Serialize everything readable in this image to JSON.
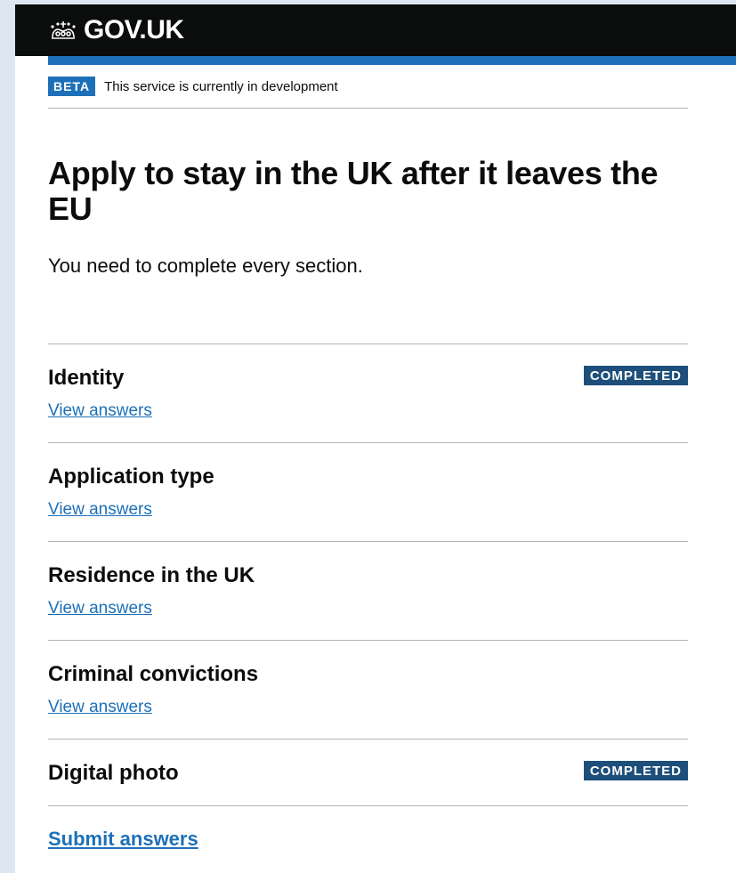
{
  "header": {
    "logo_text": "GOV.UK"
  },
  "phase_banner": {
    "tag": "BETA",
    "text": "This service is currently in development"
  },
  "main": {
    "title": "Apply to stay in the UK after it leaves the EU",
    "lead": "You need to complete every section.",
    "tasks": [
      {
        "name": "Identity",
        "link": "View answers",
        "status": "COMPLETED"
      },
      {
        "name": "Application type",
        "link": "View answers"
      },
      {
        "name": "Residence in the UK",
        "link": "View answers"
      },
      {
        "name": "Criminal convictions",
        "link": "View answers"
      },
      {
        "name": "Digital photo",
        "status": "COMPLETED"
      }
    ],
    "submit_label": "Submit answers"
  },
  "colors": {
    "header_bg": "#0b0c0c",
    "brand_blue": "#1d70b8",
    "status_tag": "#1d4f7a",
    "divider": "#b1b4b6"
  },
  "icons": {
    "logo": "crown-icon"
  }
}
